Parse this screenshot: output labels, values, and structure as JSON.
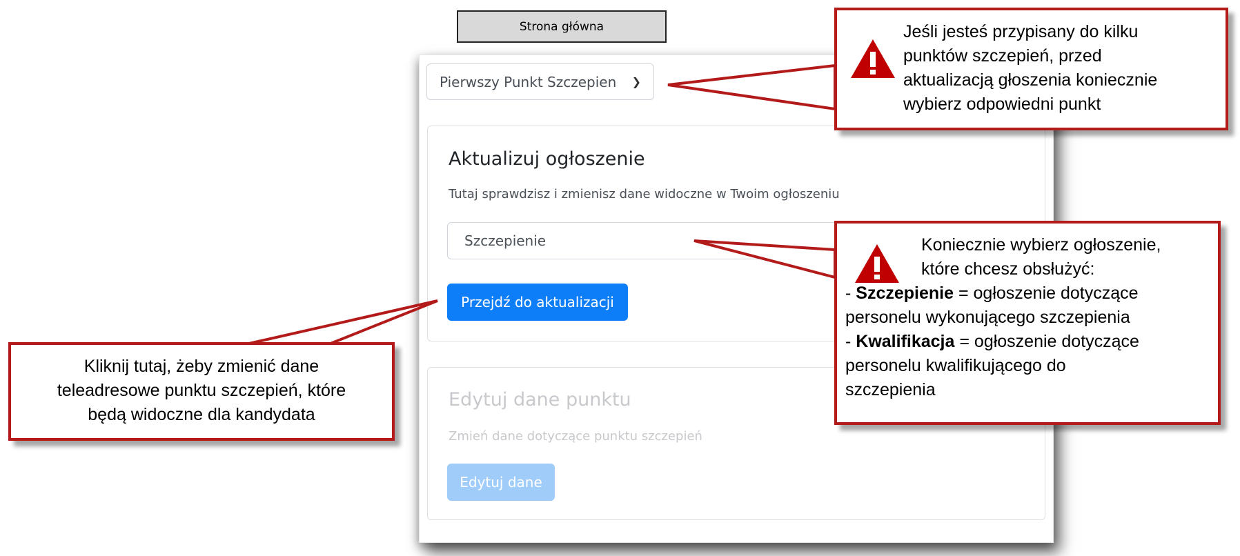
{
  "home_button": "Strona główna",
  "point_select": {
    "value": "Pierwszy Punkt Szczepien"
  },
  "update_card": {
    "title": "Aktualizuj ogłoszenie",
    "description": "Tutaj sprawdzisz i zmienisz dane widoczne w Twoim ogłoszeniu",
    "ad_select_value": "Szczepienie",
    "button": "Przejdź do aktualizacji"
  },
  "edit_card": {
    "title": "Edytuj dane punktu",
    "description": "Zmień dane dotyczące punktu szczepień",
    "button": "Edytuj dane"
  },
  "callouts": {
    "top": {
      "icon": "warning-icon",
      "lines": [
        "Jeśli jesteś przypisany do kilku",
        "punktów szczepień, przed",
        "aktualizacją głoszenia koniecznie",
        "wybierz odpowiedni punkt"
      ]
    },
    "right": {
      "icon": "warning-icon",
      "line1": "Koniecznie wybierz ogłoszenie,",
      "line2": "które chcesz obsłużyć:",
      "item1_term": "Szczepienie",
      "item1_desc_a": " = ogłoszenie dotyczące",
      "item1_desc_b": "personelu wykonującego szczepienia",
      "item2_term": "Kwalifikacja",
      "item2_desc_a": " = ogłoszenie dotyczące",
      "item2_desc_b": "personelu kwalifikującego do",
      "item2_desc_c": "szczepienia",
      "dash": "- "
    },
    "left": {
      "lines": [
        "Kliknij tutaj, żeby zmienić dane",
        "teleadresowe punktu szczepień, które",
        "będą widoczne dla kandydata"
      ]
    }
  },
  "colors": {
    "callout_border": "#b31b1b",
    "primary_button": "#0d7ef7",
    "disabled_button": "#9fccf9"
  }
}
